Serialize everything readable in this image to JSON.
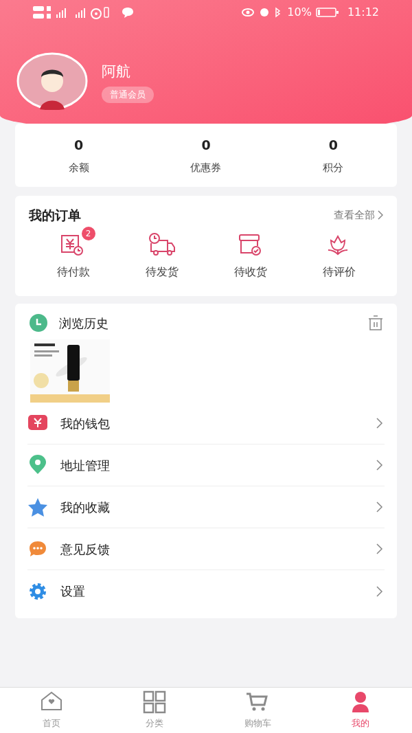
{
  "status_bar": {
    "battery": "10%",
    "time": "11:12"
  },
  "profile": {
    "name": "阿航",
    "badge": "普通会员"
  },
  "stats": [
    {
      "value": "0",
      "label": "余额"
    },
    {
      "value": "0",
      "label": "优惠券"
    },
    {
      "value": "0",
      "label": "积分"
    }
  ],
  "orders": {
    "title": "我的订单",
    "view_all": "查看全部",
    "items": [
      {
        "kind": "pay",
        "label": "待付款",
        "badge": "2"
      },
      {
        "kind": "ship",
        "label": "待发货"
      },
      {
        "kind": "receive",
        "label": "待收货"
      },
      {
        "kind": "review",
        "label": "待评价"
      }
    ]
  },
  "history": {
    "title": "浏览历史"
  },
  "menu": [
    {
      "kind": "wallet",
      "label": "我的钱包",
      "color": "#e4455e"
    },
    {
      "kind": "address",
      "label": "地址管理",
      "color": "#4cc08a"
    },
    {
      "kind": "favorite",
      "label": "我的收藏",
      "color": "#4a90e2"
    },
    {
      "kind": "feedback",
      "label": "意见反馈",
      "color": "#f08a3a"
    },
    {
      "kind": "settings",
      "label": "设置",
      "color": "#2f8de4"
    }
  ],
  "tabs": [
    {
      "kind": "home",
      "label": "首页",
      "selected": false
    },
    {
      "kind": "category",
      "label": "分类",
      "selected": false
    },
    {
      "kind": "cart",
      "label": "购物车",
      "selected": false
    },
    {
      "kind": "me",
      "label": "我的",
      "selected": true
    }
  ]
}
